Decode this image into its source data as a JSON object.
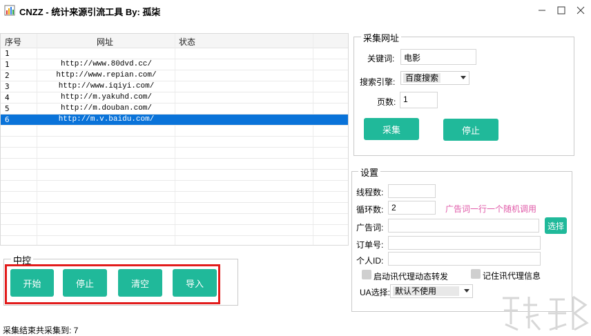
{
  "window": {
    "title": "CNZZ - 统计来源引流工具 By: 孤柒",
    "icon": "bar-chart-icon"
  },
  "table": {
    "headers": [
      "序号",
      "网址",
      "状态"
    ],
    "rows": [
      {
        "no": "1",
        "url": "",
        "status": ""
      },
      {
        "no": "1",
        "url": "http://www.80dvd.cc/",
        "status": ""
      },
      {
        "no": "2",
        "url": "http://www.repian.com/",
        "status": ""
      },
      {
        "no": "3",
        "url": "http://www.iqiyi.com/",
        "status": ""
      },
      {
        "no": "4",
        "url": "http://m.yakuhd.com/",
        "status": ""
      },
      {
        "no": "5",
        "url": "http://m.douban.com/",
        "status": ""
      },
      {
        "no": "6",
        "url": "http://m.v.baidu.com/",
        "status": ""
      }
    ],
    "selected_row_index": 6
  },
  "control": {
    "legend": "中控",
    "start": "开始",
    "stop": "停止",
    "clear": "清空",
    "import": "导入"
  },
  "collect": {
    "legend": "采集网址",
    "keyword_label": "关键词:",
    "keyword_value": "电影",
    "engine_label": "搜索引擎:",
    "engine_value": "百度搜索",
    "pages_label": "页数:",
    "pages_value": "1",
    "collect_button": "采集",
    "stop_button": "停止"
  },
  "settings": {
    "legend": "设置",
    "threads_label": "线程数:",
    "threads_value": "",
    "loops_label": "循环数:",
    "loops_value": "2",
    "ad_hint": "广告词一行一个随机调用",
    "ad_label": "广告词:",
    "ad_value": "",
    "select_button": "选择",
    "order_label": "订单号:",
    "order_value": "",
    "personal_id_label": "个人ID:",
    "personal_id_value": "",
    "proxy_dynamic_label": "启动讯代理动态转发",
    "remember_proxy_label": "记住讯代理信息",
    "ua_label": "UA选择:",
    "ua_value": "默认不使用"
  },
  "status": {
    "text": "采集结束共采集到: 7"
  },
  "colors": {
    "accent": "#20b99a",
    "selected_row": "#0a73d9",
    "highlight_border": "#e21b1b",
    "hint_text": "#e05aa8"
  }
}
